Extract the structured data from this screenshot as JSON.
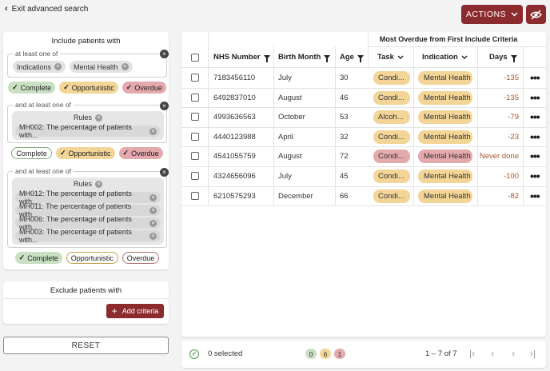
{
  "header": {
    "exit_label": "Exit advanced search",
    "actions_label": "ACTIONS"
  },
  "include": {
    "title": "Include patients with",
    "groups": [
      {
        "legend": "at least one of",
        "chips": [
          "Indications",
          "Mental Health"
        ],
        "statuses": [
          {
            "label": "Complete",
            "active": true
          },
          {
            "label": "Opportunistic",
            "active": true
          },
          {
            "label": "Overdue",
            "active": true
          }
        ]
      },
      {
        "legend": "and at least one of",
        "rules_label": "Rules",
        "rules": [
          "MH002: The percentage of patients with..."
        ],
        "statuses": [
          {
            "label": "Complete",
            "active": false
          },
          {
            "label": "Opportunistic",
            "active": true
          },
          {
            "label": "Overdue",
            "active": true
          }
        ]
      },
      {
        "legend": "and at least one of",
        "rules_label": "Rules",
        "rules": [
          "MH012: The percentage of patients with...",
          "MH011: The percentage of patients with...",
          "MH006: The percentage of patients with...",
          "MH003: The percentage of patients with..."
        ],
        "statuses": [
          {
            "label": "Complete",
            "active": true
          },
          {
            "label": "Opportunistic",
            "active": false
          },
          {
            "label": "Overdue",
            "active": false
          }
        ]
      }
    ]
  },
  "exclude": {
    "title": "Exclude patients with",
    "add_label": "Add criteria"
  },
  "reset_label": "RESET",
  "table": {
    "group_header": "Most Overdue from First Include Criteria",
    "columns": {
      "nhs": "NHS Number",
      "birth": "Birth Month",
      "age": "Age",
      "task": "Task",
      "indication": "Indication",
      "days": "Days"
    },
    "rows": [
      {
        "nhs": "7183456110",
        "birth": "July",
        "age": "30",
        "task": "Condi...",
        "indication": "Mental Health",
        "days": "-135",
        "status": "opportunistic"
      },
      {
        "nhs": "6492837010",
        "birth": "August",
        "age": "46",
        "task": "Condi...",
        "indication": "Mental Health",
        "days": "-135",
        "status": "opportunistic"
      },
      {
        "nhs": "4993636563",
        "birth": "October",
        "age": "53",
        "task": "Alcoh...",
        "indication": "Mental Health",
        "days": "-79",
        "status": "opportunistic"
      },
      {
        "nhs": "4440123988",
        "birth": "April",
        "age": "32",
        "task": "Condi...",
        "indication": "Mental Health",
        "days": "-23",
        "status": "opportunistic"
      },
      {
        "nhs": "4541055759",
        "birth": "August",
        "age": "72",
        "task": "Condi...",
        "indication": "Mental Health",
        "days": "Never done",
        "status": "overdue"
      },
      {
        "nhs": "4324656096",
        "birth": "July",
        "age": "45",
        "task": "Condi...",
        "indication": "Mental Health",
        "days": "-100",
        "status": "opportunistic"
      },
      {
        "nhs": "6210575293",
        "birth": "December",
        "age": "66",
        "task": "Condi...",
        "indication": "Mental Health",
        "days": "-82",
        "status": "opportunistic"
      }
    ]
  },
  "footer": {
    "selected_label": "0 selected",
    "counts": {
      "complete": "0",
      "opportunistic": "6",
      "overdue": "1"
    },
    "range_label": "1 – 7 of 7"
  },
  "colors": {
    "accent": "#8b2b2e",
    "complete": "#c9e0c3",
    "opportunistic": "#f2d597",
    "overdue": "#e3a9ac",
    "days_text": "#a6572a"
  },
  "icons": {
    "exit": "chevron-left-icon",
    "actions_caret": "chevron-down-icon",
    "visibility": "eye-off-icon",
    "remove": "close-icon",
    "filter": "filter-icon",
    "sort": "chevron-down-icon",
    "row_menu": "more-horiz-icon",
    "pager": [
      "first-page-icon",
      "prev-page-icon",
      "next-page-icon",
      "last-page-icon"
    ]
  }
}
